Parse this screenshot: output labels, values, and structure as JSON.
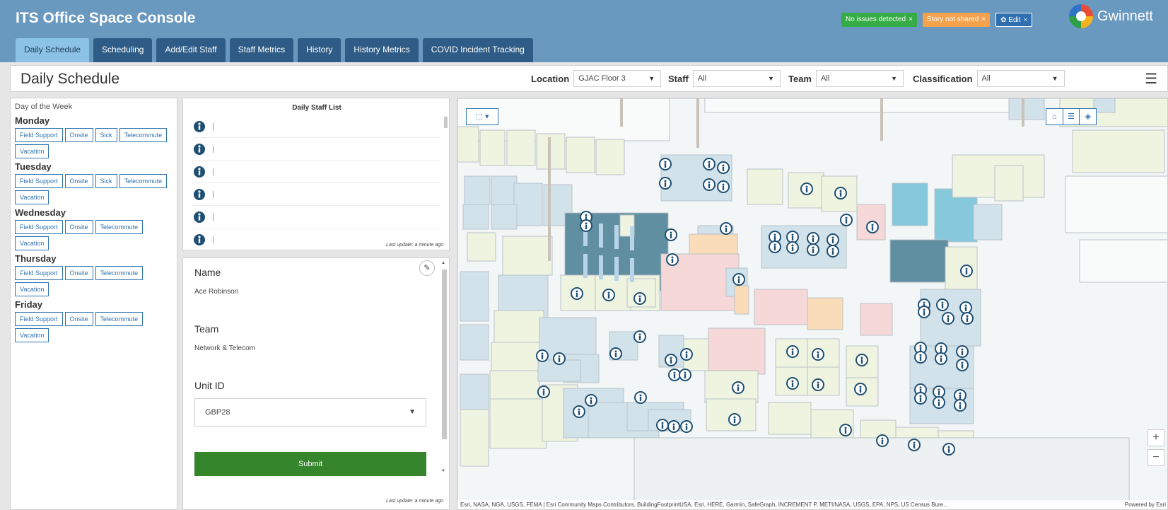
{
  "app": {
    "title": "ITS Office Space Console",
    "brand": "Gwinnett",
    "badges": [
      {
        "label": "No issues detected",
        "color": "#35ac46"
      },
      {
        "label": "Story not shared",
        "color": "#f5a24c"
      },
      {
        "label": "Edit",
        "color": "#2f6fb0"
      }
    ],
    "tabs": [
      "Daily Schedule",
      "Scheduling",
      "Add/Edit Staff",
      "Staff Metrics",
      "History",
      "History Metrics",
      "COVID Incident Tracking"
    ],
    "active_tab": "Daily Schedule"
  },
  "toolbar": {
    "page_title": "Daily Schedule",
    "location_label": "Location",
    "location_value": "GJAC Floor 3",
    "staff_label": "Staff",
    "staff_value": "All",
    "team_label": "Team",
    "team_value": "All",
    "classification_label": "Classification",
    "classification_value": "All"
  },
  "schedule": {
    "header": "Day of the Week",
    "days": [
      {
        "name": "Monday",
        "items": [
          "Field Support",
          "Onsite",
          "Sick",
          "Telecommute",
          "Vacation"
        ]
      },
      {
        "name": "Tuesday",
        "items": [
          "Field Support",
          "Onsite",
          "Sick",
          "Telecommute",
          "Vacation"
        ]
      },
      {
        "name": "Wednesday",
        "items": [
          "Field Support",
          "Onsite",
          "Telecommute",
          "Vacation"
        ]
      },
      {
        "name": "Thursday",
        "items": [
          "Field Support",
          "Onsite",
          "Telecommute",
          "Vacation"
        ]
      },
      {
        "name": "Friday",
        "items": [
          "Field Support",
          "Onsite",
          "Telecommute",
          "Vacation"
        ]
      }
    ]
  },
  "staff_list": {
    "title": "Daily Staff List",
    "row_count": 6,
    "last_update": "Last update: a minute ago"
  },
  "form": {
    "name_label": "Name",
    "name_value": "Ace Robinson",
    "team_label": "Team",
    "team_value": "Network & Telecom",
    "unit_label": "Unit ID",
    "unit_value": "GBP28",
    "submit_label": "Submit",
    "last_update": "Last update: a minute ago"
  },
  "map": {
    "zoom_in": "+",
    "zoom_out": "−",
    "attribution": "Esri, NASA, NGA, USGS, FEMA | Esri Community Maps Contributors, BuildingFootprintUSA, Esri, HERE, Garmin, SafeGraph, INCREMENT P, METI/NASA, USGS, EPA, NPS, US Census Bure...",
    "powered_by": "Powered by Esri"
  },
  "icons": {
    "info": "info-pin-icon",
    "select": "select-tool-icon",
    "home": "home-icon",
    "legend": "legend-icon",
    "layers": "layers-icon",
    "edit": "pencil-icon",
    "menu": "hamburger-icon"
  }
}
